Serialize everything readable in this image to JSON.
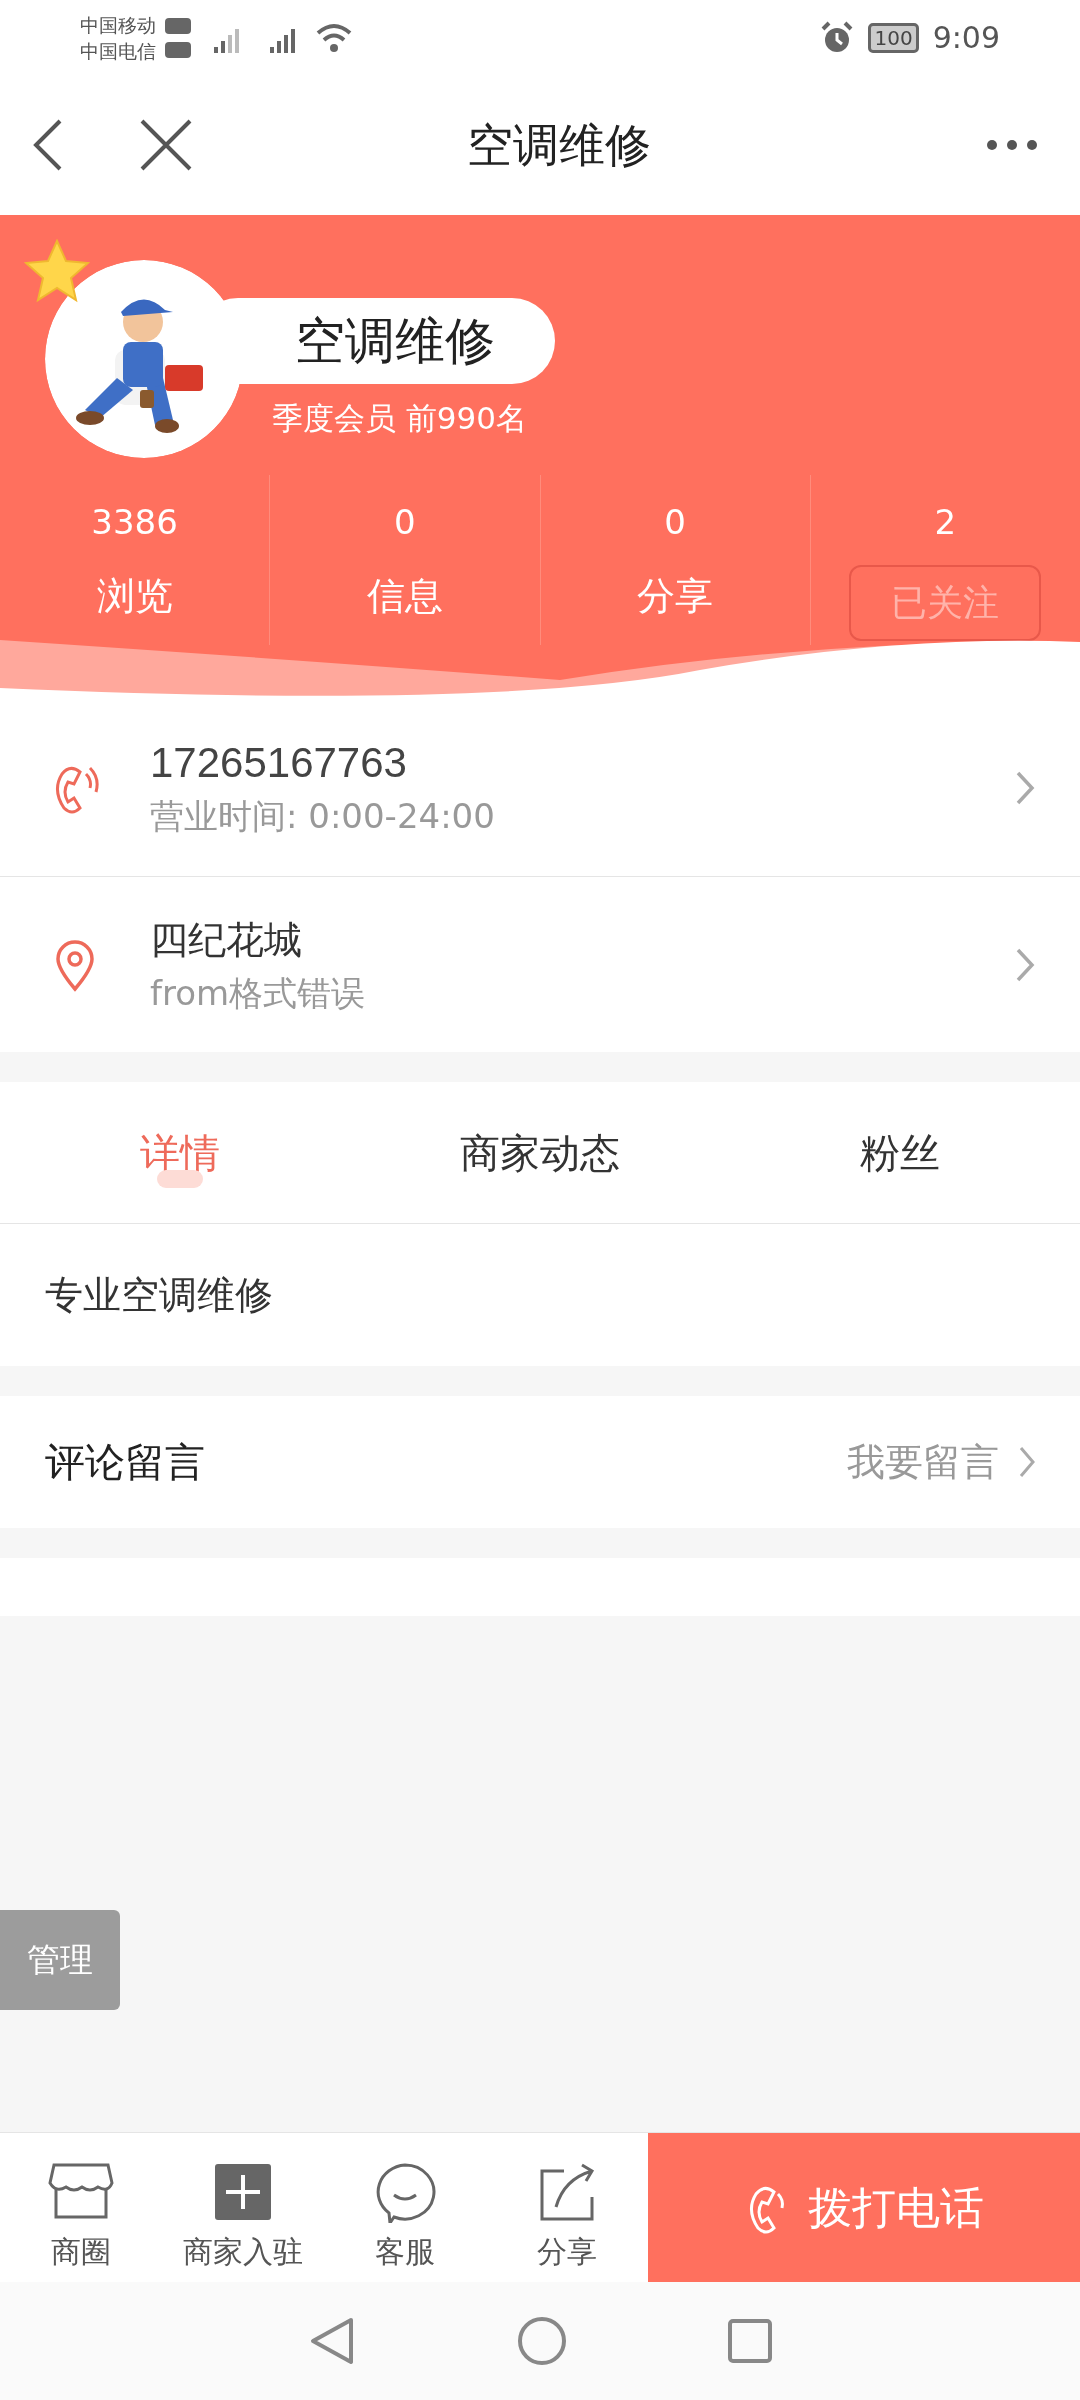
{
  "status_bar": {
    "carriers": [
      "中国移动",
      "中国电信"
    ],
    "battery": "100",
    "time": "9:09"
  },
  "nav": {
    "title": "空调维修"
  },
  "profile": {
    "name": "空调维修",
    "membership": "季度会员 前990名"
  },
  "stats": [
    {
      "value": "3386",
      "label": "浏览",
      "kind": "stat"
    },
    {
      "value": "0",
      "label": "信息",
      "kind": "stat"
    },
    {
      "value": "0",
      "label": "分享",
      "kind": "stat"
    },
    {
      "value": "2",
      "label": "已关注",
      "kind": "follow"
    }
  ],
  "contacts": [
    {
      "kind": "phone",
      "title": "17265167763",
      "subtitle": "营业时间: 0:00-24:00"
    },
    {
      "kind": "location",
      "title": "四纪花城",
      "subtitle": "from格式错误"
    }
  ],
  "tabs": [
    {
      "label": "详情",
      "selected": true
    },
    {
      "label": "商家动态",
      "selected": false
    },
    {
      "label": "粉丝",
      "selected": false
    }
  ],
  "detail": "专业空调维修",
  "comments": {
    "title": "评论留言",
    "action": "我要留言"
  },
  "manage_button": "管理",
  "bottom_bar": {
    "items": [
      {
        "kind": "shop",
        "label": "商圈"
      },
      {
        "kind": "plus",
        "label": "商家入驻"
      },
      {
        "kind": "chat",
        "label": "客服"
      },
      {
        "kind": "share",
        "label": "分享"
      }
    ],
    "call_button": "拨打电话"
  }
}
